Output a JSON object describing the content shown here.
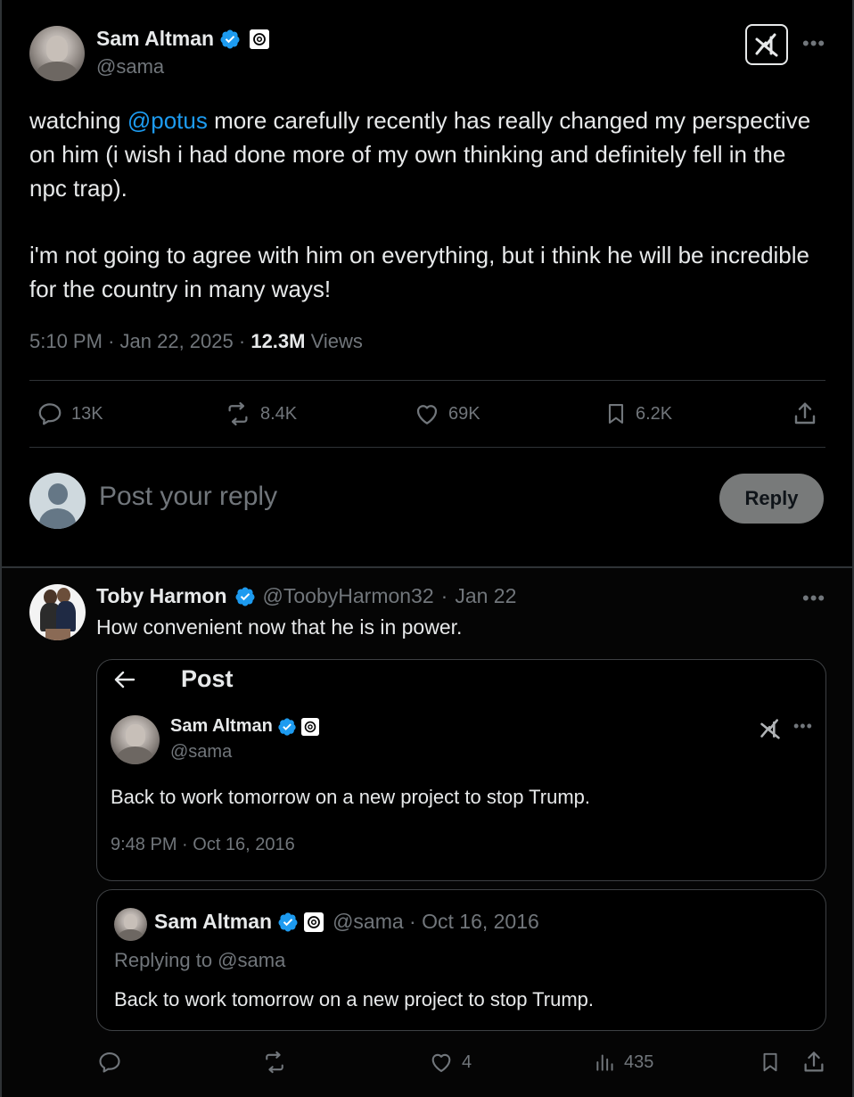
{
  "main_tweet": {
    "author_name": "Sam Altman",
    "handle": "@sama",
    "text_before_mention": "watching ",
    "mention": "@potus",
    "text_after_mention": " more carefully recently has really changed my perspective on him (i wish i had done more of my own thinking and definitely fell in the npc trap).",
    "paragraph2": "i'm not going to agree with him on everything, but i think he will be incredible for the country in many ways!",
    "time": "5:10 PM",
    "date": "Jan 22, 2025",
    "views_count": "12.3M",
    "views_label": "Views",
    "separator": "·",
    "actions": {
      "replies": "13K",
      "reposts": "8.4K",
      "likes": "69K",
      "bookmarks": "6.2K"
    }
  },
  "compose": {
    "placeholder": "Post your reply",
    "button_label": "Reply"
  },
  "reply": {
    "author_name": "Toby Harmon",
    "handle": "@ToobyHarmon32",
    "date": "Jan 22",
    "text": "How convenient now that he is in power.",
    "embedded_screenshot": {
      "header_title": "Post",
      "author_name": "Sam Altman",
      "handle": "@sama",
      "text": "Back to work tomorrow on a new project to stop Trump.",
      "timestamp": "9:48 PM · Oct 16, 2016"
    },
    "quoted": {
      "author_name": "Sam Altman",
      "handle_date": "@sama · Oct 16, 2016",
      "replying_to": "Replying to @sama",
      "text": "Back to work tomorrow on a new project to stop Trump."
    },
    "actions": {
      "likes": "4",
      "views": "435"
    }
  },
  "colors": {
    "background": "#000000",
    "accent": "#1d9bf0",
    "muted": "#71767b",
    "border": "#2f3336"
  }
}
